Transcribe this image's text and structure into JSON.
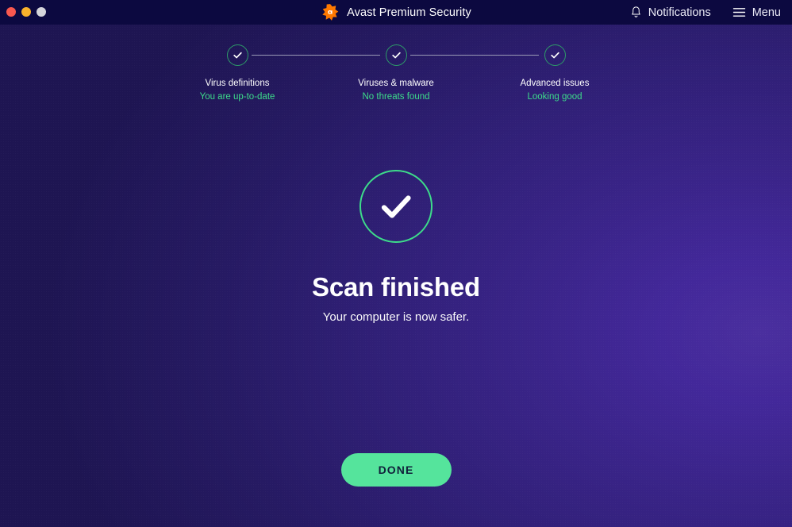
{
  "window": {
    "traffic_lights": [
      {
        "name": "close",
        "color": "#f9584f"
      },
      {
        "name": "minimize",
        "color": "#f9b22c"
      },
      {
        "name": "zoom",
        "color": "#d5d5db"
      }
    ]
  },
  "titlebar": {
    "app_title": "Avast Premium Security",
    "logo_icon": "avast-logo-icon",
    "logo_letter": "a",
    "notifications": {
      "label": "Notifications",
      "icon": "bell-icon"
    },
    "menu": {
      "label": "Menu",
      "icon": "hamburger-icon"
    }
  },
  "status_strip": {
    "items": [
      {
        "label": "Virus definitions",
        "value": "You are up-to-date",
        "icon": "check-circle-icon",
        "state": "ok"
      },
      {
        "label": "Viruses & malware",
        "value": "No threats found",
        "icon": "check-circle-icon",
        "state": "ok"
      },
      {
        "label": "Advanced issues",
        "value": "Looking good",
        "icon": "check-circle-icon",
        "state": "ok"
      }
    ]
  },
  "hero": {
    "icon": "large-check-circle-icon",
    "title": "Scan finished",
    "subtitle": "Your computer is now safer."
  },
  "footer": {
    "done_label": "DONE"
  },
  "colors": {
    "titlebar_bg": "#0c0940",
    "background_dark": "#1e1552",
    "background_light": "#4a2f9e",
    "accent_green": "#3ddc8a",
    "button_green": "#55e49c",
    "ring_green": "#2d9b68",
    "brand_orange": "#ff7800",
    "text_primary": "#ffffff",
    "connector_grey": "#9a9ab6"
  }
}
